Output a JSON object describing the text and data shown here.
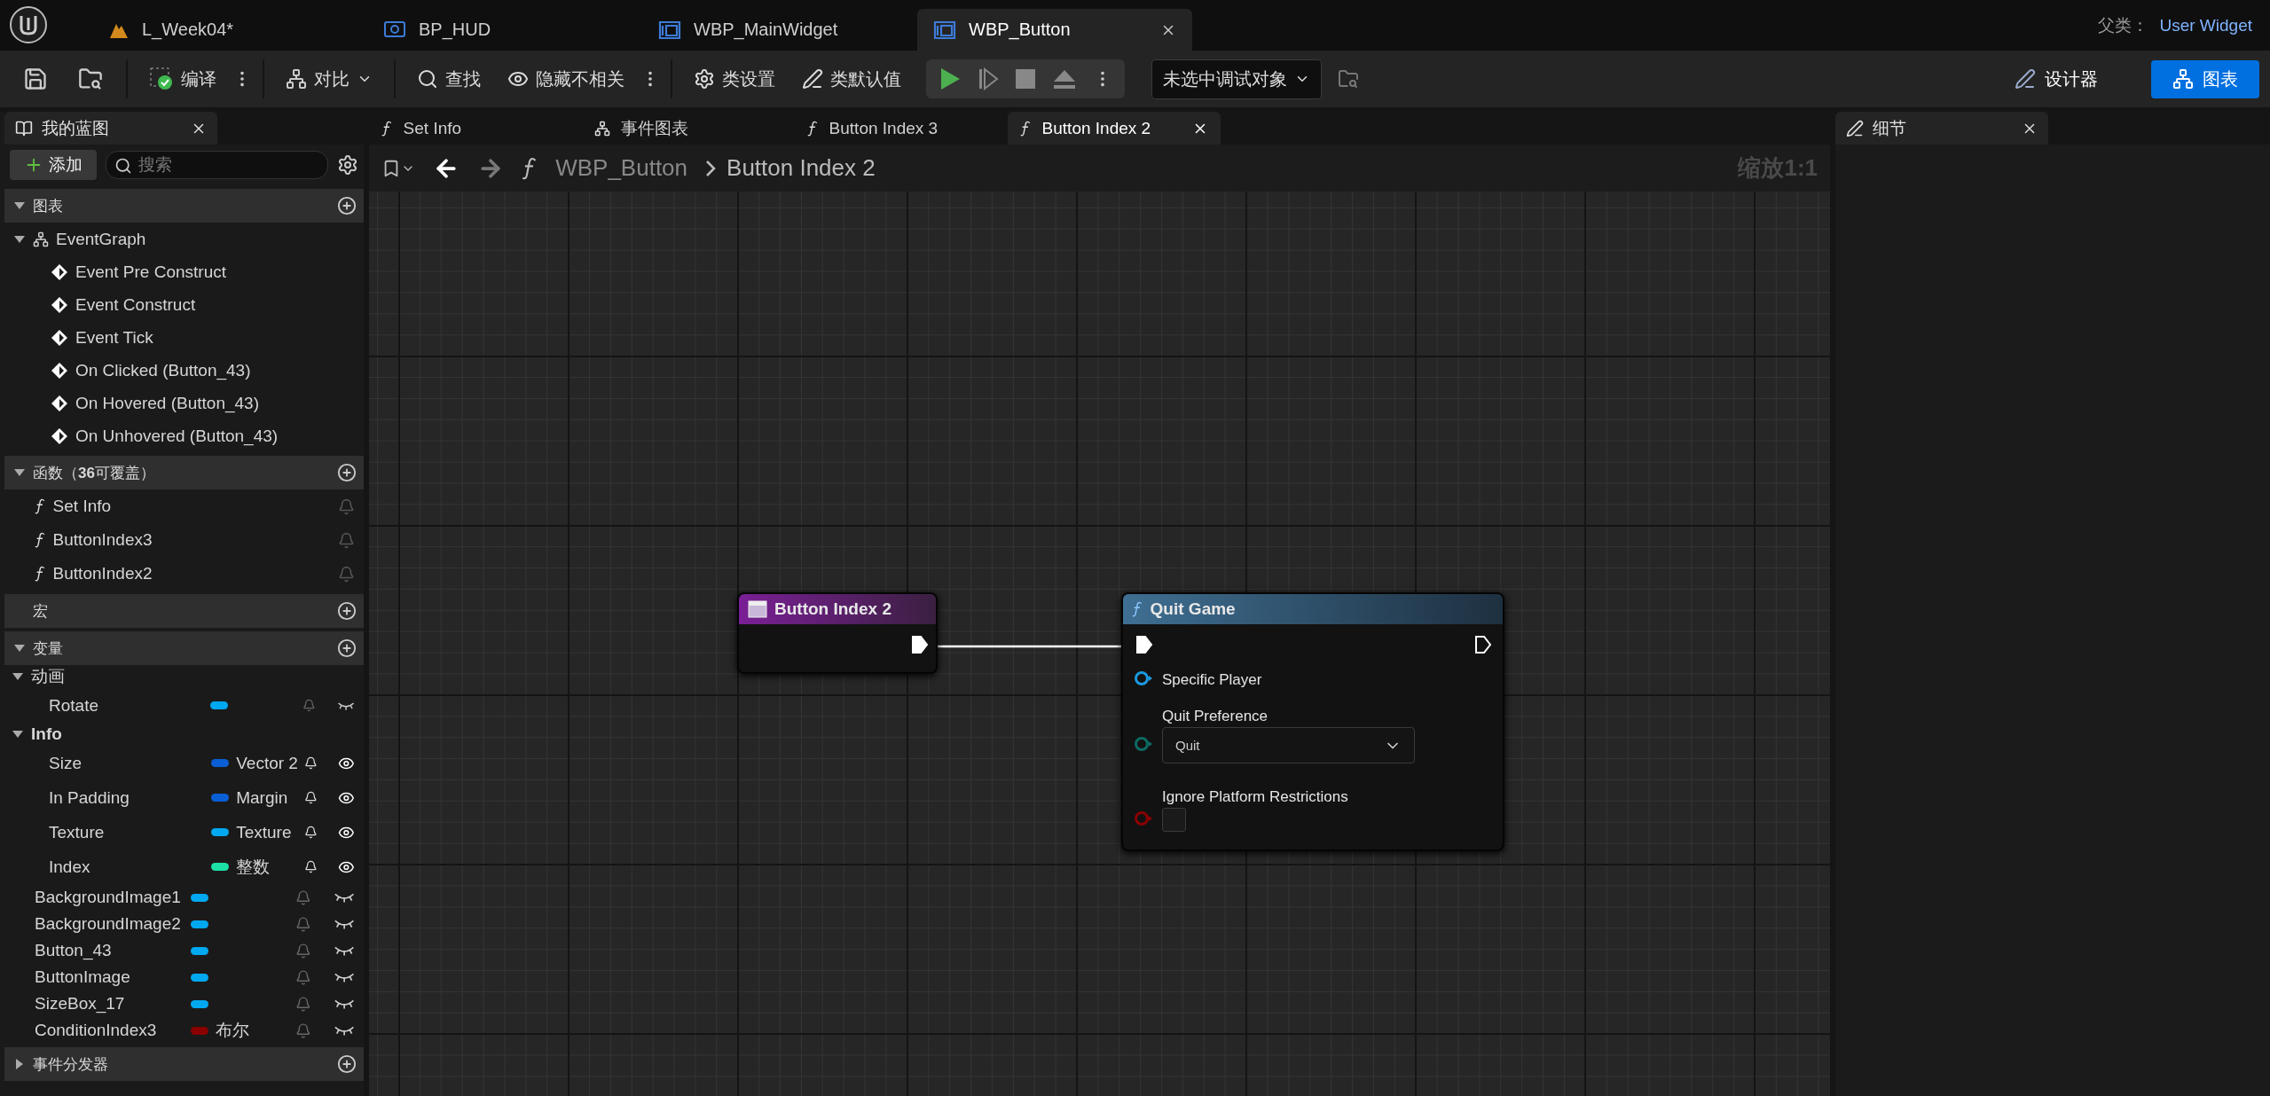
{
  "top_tabs": [
    {
      "label": "L_Week04*",
      "selected": false
    },
    {
      "label": "BP_HUD",
      "selected": false
    },
    {
      "label": "WBP_MainWidget",
      "selected": false
    },
    {
      "label": "WBP_Button",
      "selected": true
    }
  ],
  "parent_class": {
    "label": "父类：",
    "value": "User Widget"
  },
  "toolbar": {
    "compile": "编译",
    "compare": "对比",
    "find": "查找",
    "hide_unrelated": "隐藏不相关",
    "class_settings": "类设置",
    "class_defaults": "类默认值",
    "debug_target": "未选中调试对象",
    "modes": [
      {
        "label": "设计器",
        "kind": "designer",
        "selected": false
      },
      {
        "label": "图表",
        "kind": "graph",
        "selected": true
      }
    ]
  },
  "my_blueprint": {
    "title": "我的蓝图",
    "add_label": "添加",
    "search_placeholder": "搜索",
    "graphs": {
      "title": "图表",
      "expanded": true,
      "items": [
        {
          "label": "EventGraph",
          "expanded": true,
          "children": [
            {
              "label": "Event Pre Construct"
            },
            {
              "label": "Event Construct"
            },
            {
              "label": "Event Tick"
            },
            {
              "label": "On Clicked (Button_43)"
            },
            {
              "label": "On Hovered (Button_43)"
            },
            {
              "label": "On Unhovered (Button_43)"
            }
          ]
        }
      ]
    },
    "functions": {
      "title": "函数（**36**可覆盖）",
      "expanded": true,
      "items": [
        {
          "label": "Set Info"
        },
        {
          "label": "ButtonIndex3"
        },
        {
          "label": "ButtonIndex2"
        }
      ]
    },
    "macros": {
      "title": "宏"
    },
    "variables": {
      "title": "变量",
      "expanded": true,
      "categories": [
        {
          "label": "动画",
          "expanded": true,
          "items": [
            {
              "name": "Rotate",
              "color": "#00a8f0",
              "exposed": false
            }
          ]
        },
        {
          "label": "Info",
          "expanded": true,
          "items": [
            {
              "name": "Size",
              "type": "Vector 2",
              "color": "#0a5fd6",
              "exposed": true
            },
            {
              "name": "In Padding",
              "type": "Margin",
              "color": "#0a5fd6",
              "exposed": true
            },
            {
              "name": "Texture",
              "type": "Texture",
              "color": "#00a8f0",
              "exposed": true
            },
            {
              "name": "Index",
              "type": "整数",
              "color": "#1de0a6",
              "exposed": true
            }
          ]
        }
      ],
      "items": [
        {
          "name": "BackgroundImage1",
          "color": "#00a8f0",
          "exposed": false
        },
        {
          "name": "BackgroundImage2",
          "color": "#00a8f0",
          "exposed": false
        },
        {
          "name": "Button_43",
          "color": "#00a8f0",
          "exposed": false
        },
        {
          "name": "ButtonImage",
          "color": "#00a8f0",
          "exposed": false
        },
        {
          "name": "SizeBox_17",
          "color": "#00a8f0",
          "exposed": false
        },
        {
          "name": "ConditionIndex3",
          "type": "布尔",
          "color": "#8a0000",
          "exposed": false
        }
      ]
    },
    "dispatchers": {
      "title": "事件分发器"
    }
  },
  "doc_tabs": [
    {
      "label": "Set Info",
      "kind": "function",
      "selected": false
    },
    {
      "label": "事件图表",
      "kind": "graph",
      "selected": false
    },
    {
      "label": "Button Index 3",
      "kind": "function",
      "selected": false
    },
    {
      "label": "Button Index 2",
      "kind": "function",
      "selected": true
    }
  ],
  "breadcrumb": {
    "root": "WBP_Button",
    "current": "Button Index 2",
    "zoom": "缩放1:1"
  },
  "graph": {
    "entry_node": {
      "title": "Button Index 2"
    },
    "call_node": {
      "title": "Quit Game",
      "exec_connected": true,
      "pins": [
        {
          "label": "Specific Player",
          "kind": "object",
          "color": "#1a9ae0"
        },
        {
          "label": "Quit Preference",
          "kind": "enum",
          "color": "#0d6b63",
          "value": "Quit"
        },
        {
          "label": "Ignore Platform Restrictions",
          "kind": "bool",
          "color": "#8a0000",
          "checked": false
        }
      ]
    }
  },
  "details": {
    "title": "细节"
  }
}
